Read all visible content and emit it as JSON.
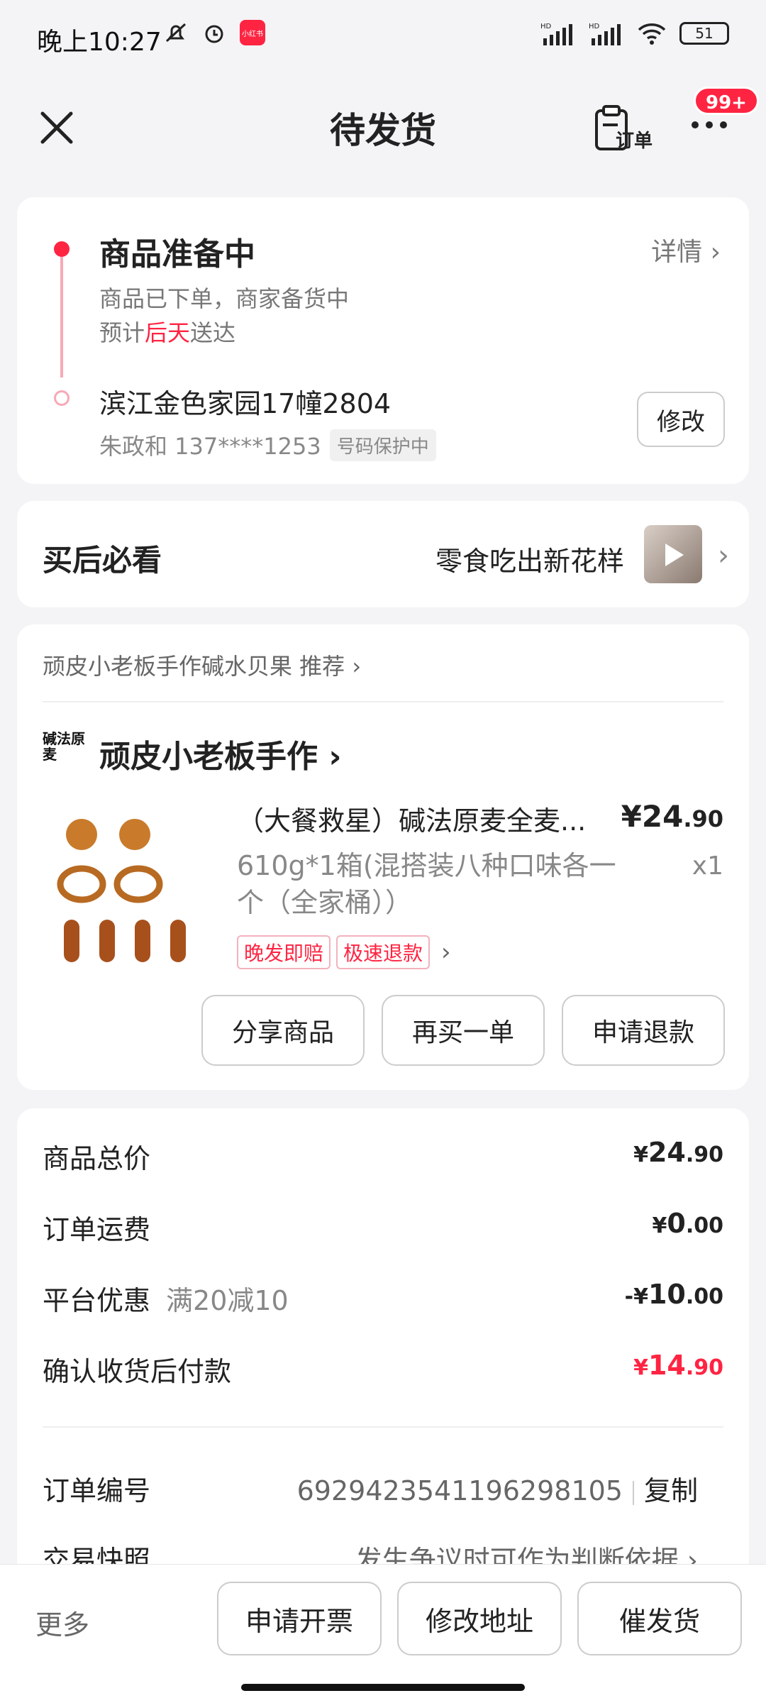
{
  "status_bar": {
    "time": "晚上10:27",
    "app_icon_text": "小红书",
    "network_1": "HD",
    "network_2": "HD",
    "battery": "51"
  },
  "nav": {
    "title": "待发货",
    "order_label": "订单",
    "badge": "99+"
  },
  "shipping": {
    "status_title": "商品准备中",
    "detail_link": "详情 ›",
    "status_sub": "商品已下单，商家备货中",
    "eta_prefix": "预计",
    "eta_highlight": "后天",
    "eta_suffix": "送达",
    "address": "滨江金色家园17幢2804",
    "contact_name_phone": "朱政和 137****1253",
    "privacy_tag": "号码保护中",
    "modify_button": "修改"
  },
  "must_see": {
    "title": "买后必看",
    "promo_text": "零食吃出新花样",
    "chevron": "›"
  },
  "product_card": {
    "recommend_line": "顽皮小老板手作碱水贝果 推荐 ›",
    "shop_logo_text": "碱法原麦",
    "shop_name": "顽皮小老板手作 ›",
    "product_title": "（大餐救星）碱法原麦全麦...",
    "price_main": "¥24",
    "price_dec": ".90",
    "spec": "610g*1箱(混搭装八种口味各一个（全家桶））",
    "qty": "x1",
    "tags": [
      "晚发即赔",
      "极速退款"
    ],
    "tag_chevron": "›",
    "buttons": {
      "share": "分享商品",
      "rebuy": "再买一单",
      "refund": "申请退款"
    }
  },
  "summary": {
    "rows": [
      {
        "label": "商品总价",
        "sub": "",
        "cur": "¥",
        "int": "24",
        "dec": ".90"
      },
      {
        "label": "订单运费",
        "sub": "",
        "cur": "¥",
        "int": "0",
        "dec": ".00"
      },
      {
        "label": "平台优惠",
        "sub": "满20减10",
        "cur": "-¥",
        "int": "10",
        "dec": ".00"
      },
      {
        "label": "确认收货后付款",
        "sub": "",
        "cur": "¥",
        "int": "14",
        "dec": ".90"
      }
    ],
    "order_no_label": "订单编号",
    "order_no": "6929423541196298105",
    "copy": "复制",
    "snapshot_label": "交易快照",
    "snapshot_value": "发生争议时可作为判断依据 ›"
  },
  "bottom_bar": {
    "more": "更多",
    "invoice": "申请开票",
    "change_address": "修改地址",
    "urge": "催发货"
  },
  "colors": {
    "accent": "#ff2442",
    "timeline": "#f7a9b6"
  }
}
